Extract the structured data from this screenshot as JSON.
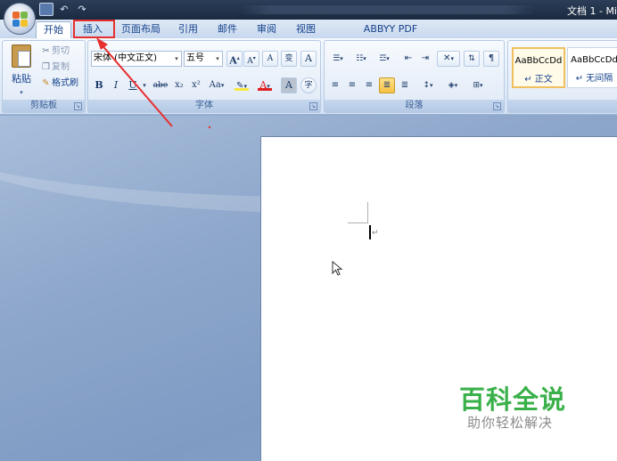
{
  "window": {
    "title": "文档 1 - Mi"
  },
  "quick_access": [
    {
      "icon": "save-icon"
    },
    {
      "icon": "undo-icon",
      "glyph": "↶"
    },
    {
      "icon": "redo-icon",
      "glyph": "↷"
    }
  ],
  "tabs": [
    {
      "label": "开始",
      "active": true
    },
    {
      "label": "插入",
      "highlighted": true
    },
    {
      "label": "页面布局"
    },
    {
      "label": "引用"
    },
    {
      "label": "邮件"
    },
    {
      "label": "审阅"
    },
    {
      "label": "视图"
    },
    {
      "label": "ABBYY PDF Transformer+"
    }
  ],
  "clipboard": {
    "label": "剪贴板",
    "paste": "粘贴",
    "cut": "剪切",
    "copy": "复制",
    "format_painter": "格式刷"
  },
  "font": {
    "label": "字体",
    "name": "宋体 (中文正文)",
    "size": "五号",
    "bold": "B",
    "italic": "I",
    "underline": "U",
    "strike": "abe",
    "subscript": "x₂",
    "superscript": "x²",
    "change_case": "Aa",
    "grow": "A",
    "shrink": "A",
    "clear": "A",
    "phonetic": "变",
    "border": "A",
    "color_a": "A",
    "shade_a": "A",
    "enclose": "字",
    "colors": {
      "highlight": "#f7e842",
      "font_color": "#e02020"
    }
  },
  "paragraph": {
    "label": "段落"
  },
  "styles": [
    {
      "sample": "AaBbCcDd",
      "name": "↵ 正文",
      "selected": true
    },
    {
      "sample": "AaBbCcDd",
      "name": "↵ 无间隔"
    }
  ],
  "watermark": {
    "title": "百科全说",
    "subtitle": "助你轻松解决"
  },
  "colors": {
    "annotation": "#e63030",
    "watermark": "#3ab04a"
  }
}
